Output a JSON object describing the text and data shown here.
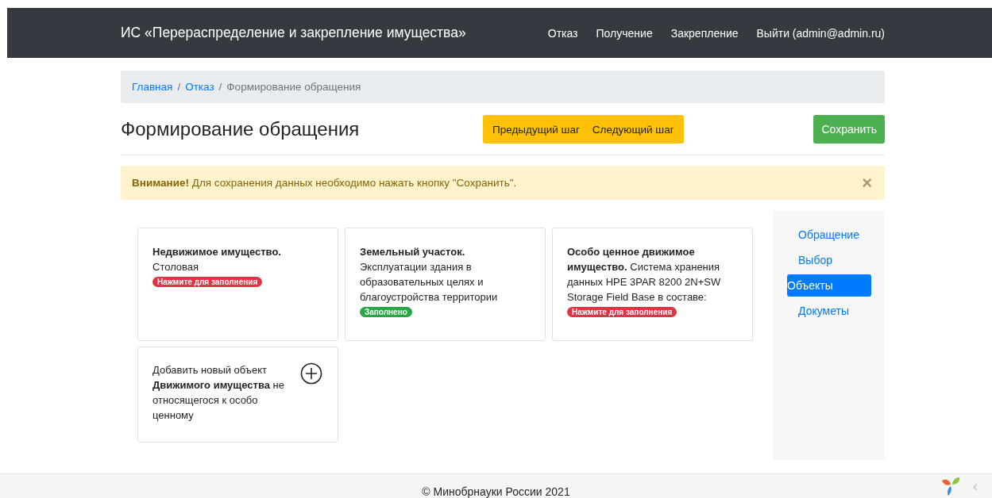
{
  "navbar": {
    "brand": "ИС «Перераспределение и закрепление имущества»",
    "links": [
      "Отказ",
      "Получение",
      "Закрепление",
      "Выйти (admin@admin.ru)"
    ]
  },
  "breadcrumb_separator": "/",
  "breadcrumb": [
    {
      "label": "Главная",
      "link": true
    },
    {
      "label": "Отказ",
      "link": true
    },
    {
      "label": "Формирование обращения",
      "link": false
    }
  ],
  "heading": "Формирование обращения",
  "step_buttons": [
    "Предыдущий шаг",
    "Следующий шаг"
  ],
  "save_button": "Сохранить",
  "alert": {
    "text": "**Внимание!** Для сохранения данных необходимо нажать кнопку \"Сохранить\".",
    "close": "×"
  },
  "cards": [
    {
      "kind": "object",
      "title": "Недвижимое имущество.",
      "text": "Столовая",
      "badge": {
        "label": "Нажмите для заполнения",
        "filled": false
      }
    },
    {
      "kind": "object",
      "title": "Земельный участок.",
      "text": "Эксплуатации здания в образовательных целях и благоустройства территории",
      "badge": {
        "label": "Заполнено",
        "filled": true
      }
    },
    {
      "kind": "object",
      "title": "Особо ценное движимое имущество.",
      "text": "Система хранения данных HPE 3PAR 8200 2N+SW Storage Field Base в составе:",
      "badge": {
        "label": "Нажмите для заполнения",
        "filled": false
      }
    },
    {
      "kind": "add",
      "text": "Добавить новый объект **Движимого имущества** не относящегося к особо ценному"
    }
  ],
  "side_nav": [
    {
      "label": "Обращение",
      "selected": false
    },
    {
      "label": "Выбор",
      "selected": false
    },
    {
      "label": "Объекты",
      "selected": true
    },
    {
      "label": "Докуметы",
      "selected": false
    }
  ],
  "footer": "© Минобрнауки России 2021",
  "debug_toggle": "‹"
}
